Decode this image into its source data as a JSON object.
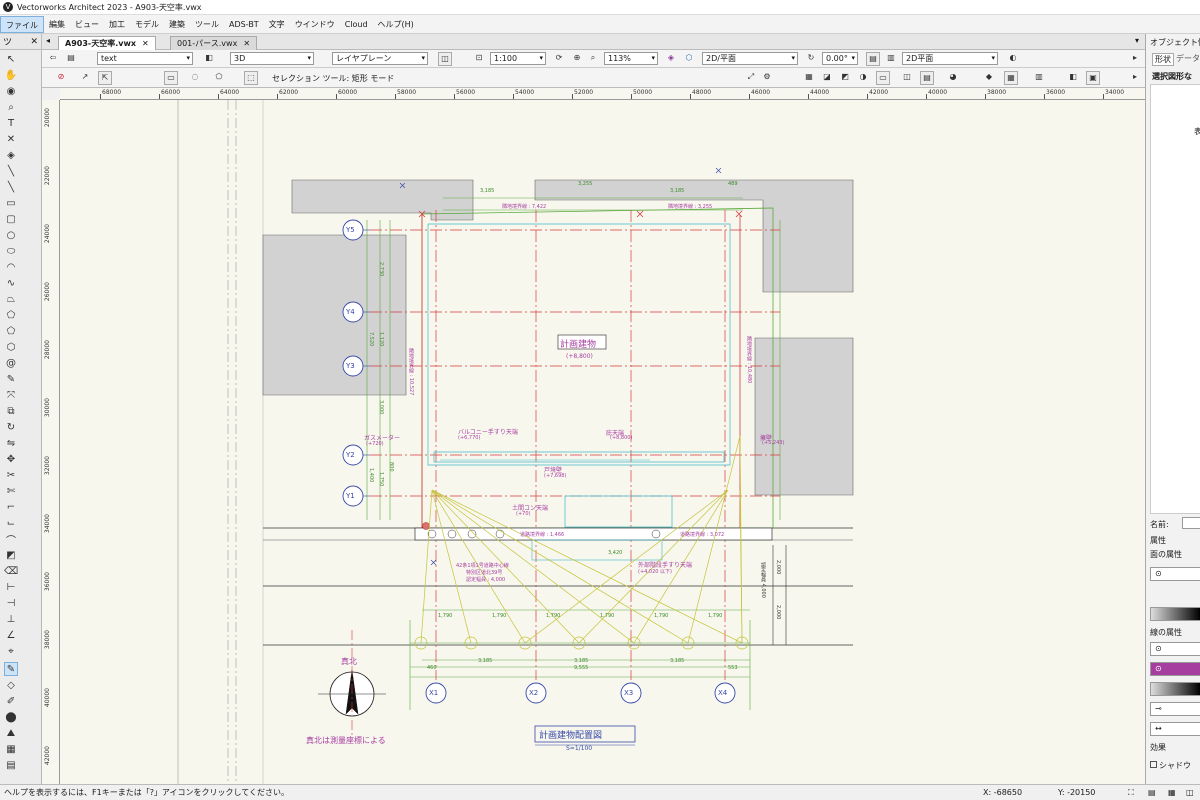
{
  "app_title": "Vectorworks Architect 2023 - A903-天空率.vwx",
  "menu": [
    {
      "label": "ファイル",
      "active": true
    },
    {
      "label": "編集"
    },
    {
      "label": "ビュー"
    },
    {
      "label": "加工"
    },
    {
      "label": "モデル"
    },
    {
      "label": "建築"
    },
    {
      "label": "ツール"
    },
    {
      "label": "ADS-BT"
    },
    {
      "label": "文字"
    },
    {
      "label": "ウインドウ"
    },
    {
      "label": "Cloud"
    },
    {
      "label": "ヘルプ(H)"
    }
  ],
  "toolbox_header": "ツ",
  "tabs": [
    {
      "label": "A903-天空率.vwx",
      "active": true
    },
    {
      "label": "001-パース.vwx",
      "active": false
    }
  ],
  "viewbar": {
    "class_select": "text",
    "view_select": "3D",
    "layer_select": "レイヤプレーン",
    "scale": "1:100",
    "zoom": "113%",
    "view_mode": "2D/平面",
    "rotation": "0.00°",
    "render_mode": "2D平面"
  },
  "modebar": {
    "tool_label": "セレクション ツール: 矩形 モード"
  },
  "hruler_ticks": [
    "68000",
    "66000",
    "64000",
    "62000",
    "60000",
    "58000",
    "56000",
    "54000",
    "52000",
    "50000",
    "48000",
    "46000",
    "44000",
    "42000",
    "40000",
    "38000",
    "36000",
    "34000"
  ],
  "vruler_ticks": [
    "20000",
    "22000",
    "24000",
    "26000",
    "28000",
    "30000",
    "32000",
    "34000",
    "36000",
    "38000",
    "40000",
    "42000"
  ],
  "drawing": {
    "building_name": "計画建物",
    "building_height": "(+8,800)",
    "true_north": "真北",
    "north_note": "真北は測量座標による",
    "drawing_title": "計画建物配置図",
    "drawing_scale": "S=1/100",
    "grid_y": [
      "Y5",
      "Y4",
      "Y3",
      "Y2",
      "Y1"
    ],
    "grid_x": [
      "X1",
      "X2",
      "X3",
      "X4"
    ],
    "annotations": [
      {
        "text": "隣地境界線 : 7,422"
      },
      {
        "text": "隣地境界線 : 3,255"
      },
      {
        "text": "バルコニー手すり天端"
      },
      {
        "text": "(+6,770)"
      },
      {
        "text": "庇天端"
      },
      {
        "text": "(+8,800)"
      },
      {
        "text": "ガスメーター"
      },
      {
        "text": "(+720)"
      },
      {
        "text": "擁壁"
      },
      {
        "text": "(+5,243)"
      },
      {
        "text": "戸境壁"
      },
      {
        "text": "(+7,698)"
      },
      {
        "text": "土間コン天端"
      },
      {
        "text": "(+70)"
      },
      {
        "text": "道路境界線 : 1,466"
      },
      {
        "text": "道路境界線 : 3,072"
      },
      {
        "text": "42条1項1号道路中心線"
      },
      {
        "text": "特別区道北39号"
      },
      {
        "text": "認定幅員 : 4,000"
      },
      {
        "text": "外部階段手すり天端"
      },
      {
        "text": "(+4,020 以下)"
      },
      {
        "text": "隣地境界線 : 10,527"
      },
      {
        "text": "隣地境界線 : 10,480"
      },
      {
        "text": "認定幅員 4,000"
      }
    ],
    "dims": {
      "top": [
        "3,185",
        "3,255",
        "3,185",
        "489"
      ],
      "bottom": [
        "460",
        "3,185",
        "3,185",
        "3,185",
        "553"
      ],
      "total": "9,555",
      "mid": "3,420",
      "spans": [
        "1,790",
        "1,790",
        "1,790",
        "1,790",
        "1,790",
        "1,790"
      ]
    },
    "left_dims": [
      "2,730",
      "1,120",
      "7,520",
      "3,000",
      "1,400",
      "1,750",
      "800"
    ],
    "right_dims": [
      "2,000",
      "2,000"
    ]
  },
  "panel": {
    "title": "オブジェクト情報",
    "tabs": [
      "形状",
      "データ"
    ],
    "header": "選択図形な",
    "body_text": "表",
    "name_label": "名前:",
    "attributes_label": "属性",
    "fill_label": "面の属性",
    "line_label": "線の属性",
    "effect_label": "効果",
    "shadow_label": "シャドウ",
    "accent": "#a63ea0"
  },
  "status": {
    "help_text": "ヘルプを表示するには、F1キーまたは「?」アイコンをクリックしてください。",
    "x_coord": "X: -68650",
    "y_coord": "Y: -20150"
  }
}
